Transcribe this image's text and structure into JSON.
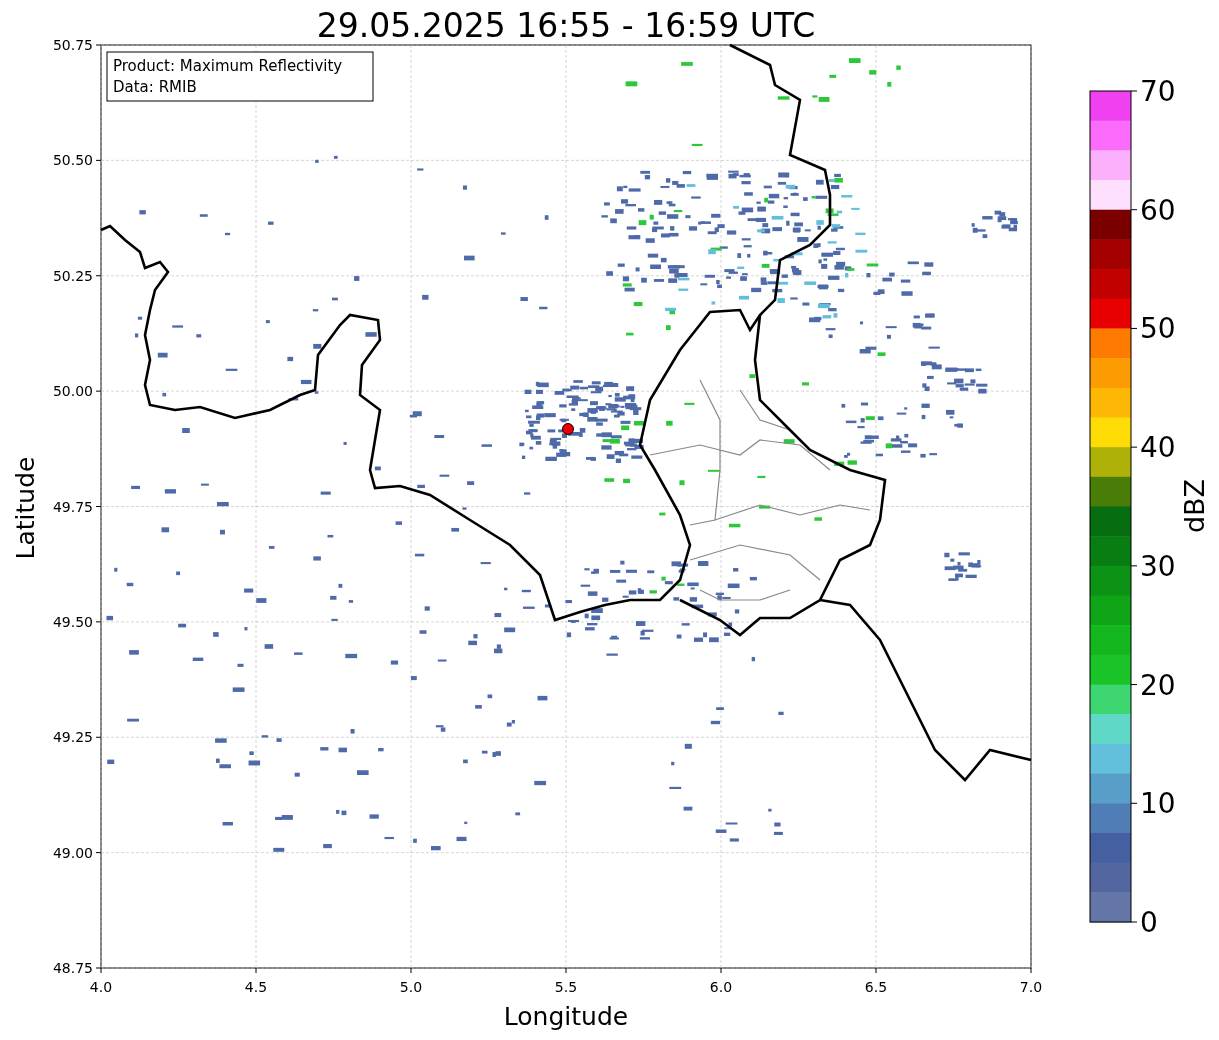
{
  "title": "29.05.2025 16:55 - 16:59 UTC",
  "info_box": [
    "Product: Maximum Reflectivity",
    "Data: RMIB"
  ],
  "x_axis": {
    "label": "Longitude",
    "ticks": [
      "4.0",
      "4.5",
      "5.0",
      "5.5",
      "6.0",
      "6.5",
      "7.0"
    ]
  },
  "y_axis": {
    "label": "Latitude",
    "ticks": [
      "50.75",
      "50.50",
      "50.25",
      "50.00",
      "49.75",
      "49.50",
      "49.25",
      "49.00",
      "48.75"
    ]
  },
  "colorbar": {
    "label": "dBZ",
    "ticks": [
      "70",
      "60",
      "50",
      "40",
      "30",
      "20",
      "10",
      "0"
    ],
    "segments": [
      {
        "color": "#f040f0"
      },
      {
        "color": "#fc6cfc"
      },
      {
        "color": "#fcb0fc"
      },
      {
        "color": "#fee0fe"
      },
      {
        "color": "#7a0000"
      },
      {
        "color": "#a40000"
      },
      {
        "color": "#c20000"
      },
      {
        "color": "#e80000"
      },
      {
        "color": "#fd7b00"
      },
      {
        "color": "#fd9b03"
      },
      {
        "color": "#fdb806"
      },
      {
        "color": "#fddc06"
      },
      {
        "color": "#aeb208"
      },
      {
        "color": "#4a7d08"
      },
      {
        "color": "#066d10"
      },
      {
        "color": "#087e12"
      },
      {
        "color": "#0c9214"
      },
      {
        "color": "#10a516"
      },
      {
        "color": "#14b81e"
      },
      {
        "color": "#1ac428"
      },
      {
        "color": "#3ed670"
      },
      {
        "color": "#60d8c8"
      },
      {
        "color": "#63c0dc"
      },
      {
        "color": "#579fc8"
      },
      {
        "color": "#4f7db5"
      },
      {
        "color": "#4560a0"
      },
      {
        "color": "#5466a0"
      },
      {
        "color": "#6475a8"
      }
    ]
  }
}
